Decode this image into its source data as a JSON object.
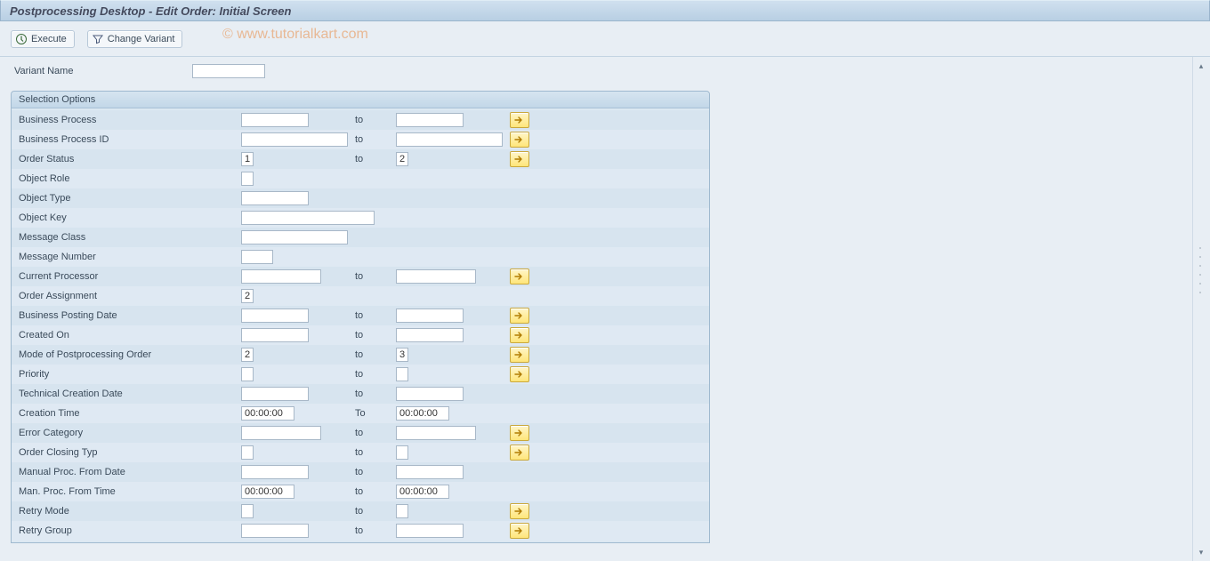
{
  "title": "Postprocessing Desktop  - Edit Order: Initial Screen",
  "toolbar": {
    "execute": "Execute",
    "change_variant": "Change Variant"
  },
  "watermark": "© www.tutorialkart.com",
  "variant": {
    "label": "Variant Name",
    "value": ""
  },
  "group_title": "Selection Options",
  "to_word": "to",
  "to_word_cap": "To",
  "rows": {
    "business_process": {
      "label": "Business Process",
      "from": "",
      "to": "",
      "multi": true,
      "fw": "w80",
      "tw": "w80"
    },
    "business_process_id": {
      "label": "Business Process ID",
      "from": "",
      "to": "",
      "multi": true,
      "fw": "wlong",
      "tw": "wlong"
    },
    "order_status": {
      "label": "Order Status",
      "from": "1",
      "to": "2",
      "multi": true,
      "fw": "wtiny",
      "tw": "wtiny"
    },
    "object_role": {
      "label": "Object Role",
      "from": "",
      "fw": "wtiny"
    },
    "object_type": {
      "label": "Object Type",
      "from": "",
      "fw": "w80"
    },
    "object_key": {
      "label": "Object Key",
      "from": "",
      "fw": "wkey"
    },
    "message_class": {
      "label": "Message Class",
      "from": "",
      "fw": "wlong"
    },
    "message_number": {
      "label": "Message Number",
      "from": "",
      "fw": "wshort"
    },
    "current_processor": {
      "label": "Current Processor",
      "from": "",
      "to": "",
      "multi": true,
      "fw": "wmed",
      "tw": "wmed"
    },
    "order_assignment": {
      "label": "Order Assignment",
      "from": "2",
      "fw": "wtiny"
    },
    "business_posting_date": {
      "label": "Business Posting Date",
      "from": "",
      "to": "",
      "multi": true,
      "fw": "w80",
      "tw": "w80"
    },
    "created_on": {
      "label": "Created On",
      "from": "",
      "to": "",
      "multi": true,
      "fw": "w80",
      "tw": "w80"
    },
    "mode_postproc_order": {
      "label": "Mode of Postprocessing Order",
      "from": "2",
      "to": "3",
      "multi": true,
      "fw": "wtiny",
      "tw": "wtiny"
    },
    "priority": {
      "label": "Priority",
      "from": "",
      "to": "",
      "multi": true,
      "fw": "wtiny",
      "tw": "wtiny"
    },
    "technical_creation_date": {
      "label": "Technical Creation Date",
      "from": "",
      "to": "",
      "fw": "w80",
      "tw": "w80"
    },
    "creation_time": {
      "label": "Creation Time",
      "from": "00:00:00",
      "to": "00:00:00",
      "to_cap": true,
      "fw": "wtime",
      "tw": "wtime"
    },
    "error_category": {
      "label": "Error Category",
      "from": "",
      "to": "",
      "multi": true,
      "fw": "wmed",
      "tw": "wmed"
    },
    "order_closing_typ": {
      "label": "Order Closing Typ",
      "from": "",
      "to": "",
      "multi": true,
      "fw": "wtiny",
      "tw": "wtiny"
    },
    "manual_proc_from_date": {
      "label": "Manual Proc. From Date",
      "from": "",
      "to": "",
      "fw": "w80",
      "tw": "w80"
    },
    "man_proc_from_time": {
      "label": "Man. Proc. From Time",
      "from": "00:00:00",
      "to": "00:00:00",
      "fw": "wtime",
      "tw": "wtime"
    },
    "retry_mode": {
      "label": "Retry Mode",
      "from": "",
      "to": "",
      "multi": true,
      "fw": "wtiny",
      "tw": "wtiny"
    },
    "retry_group": {
      "label": "Retry Group",
      "from": "",
      "to": "",
      "multi": true,
      "fw": "w80",
      "tw": "w80"
    }
  }
}
